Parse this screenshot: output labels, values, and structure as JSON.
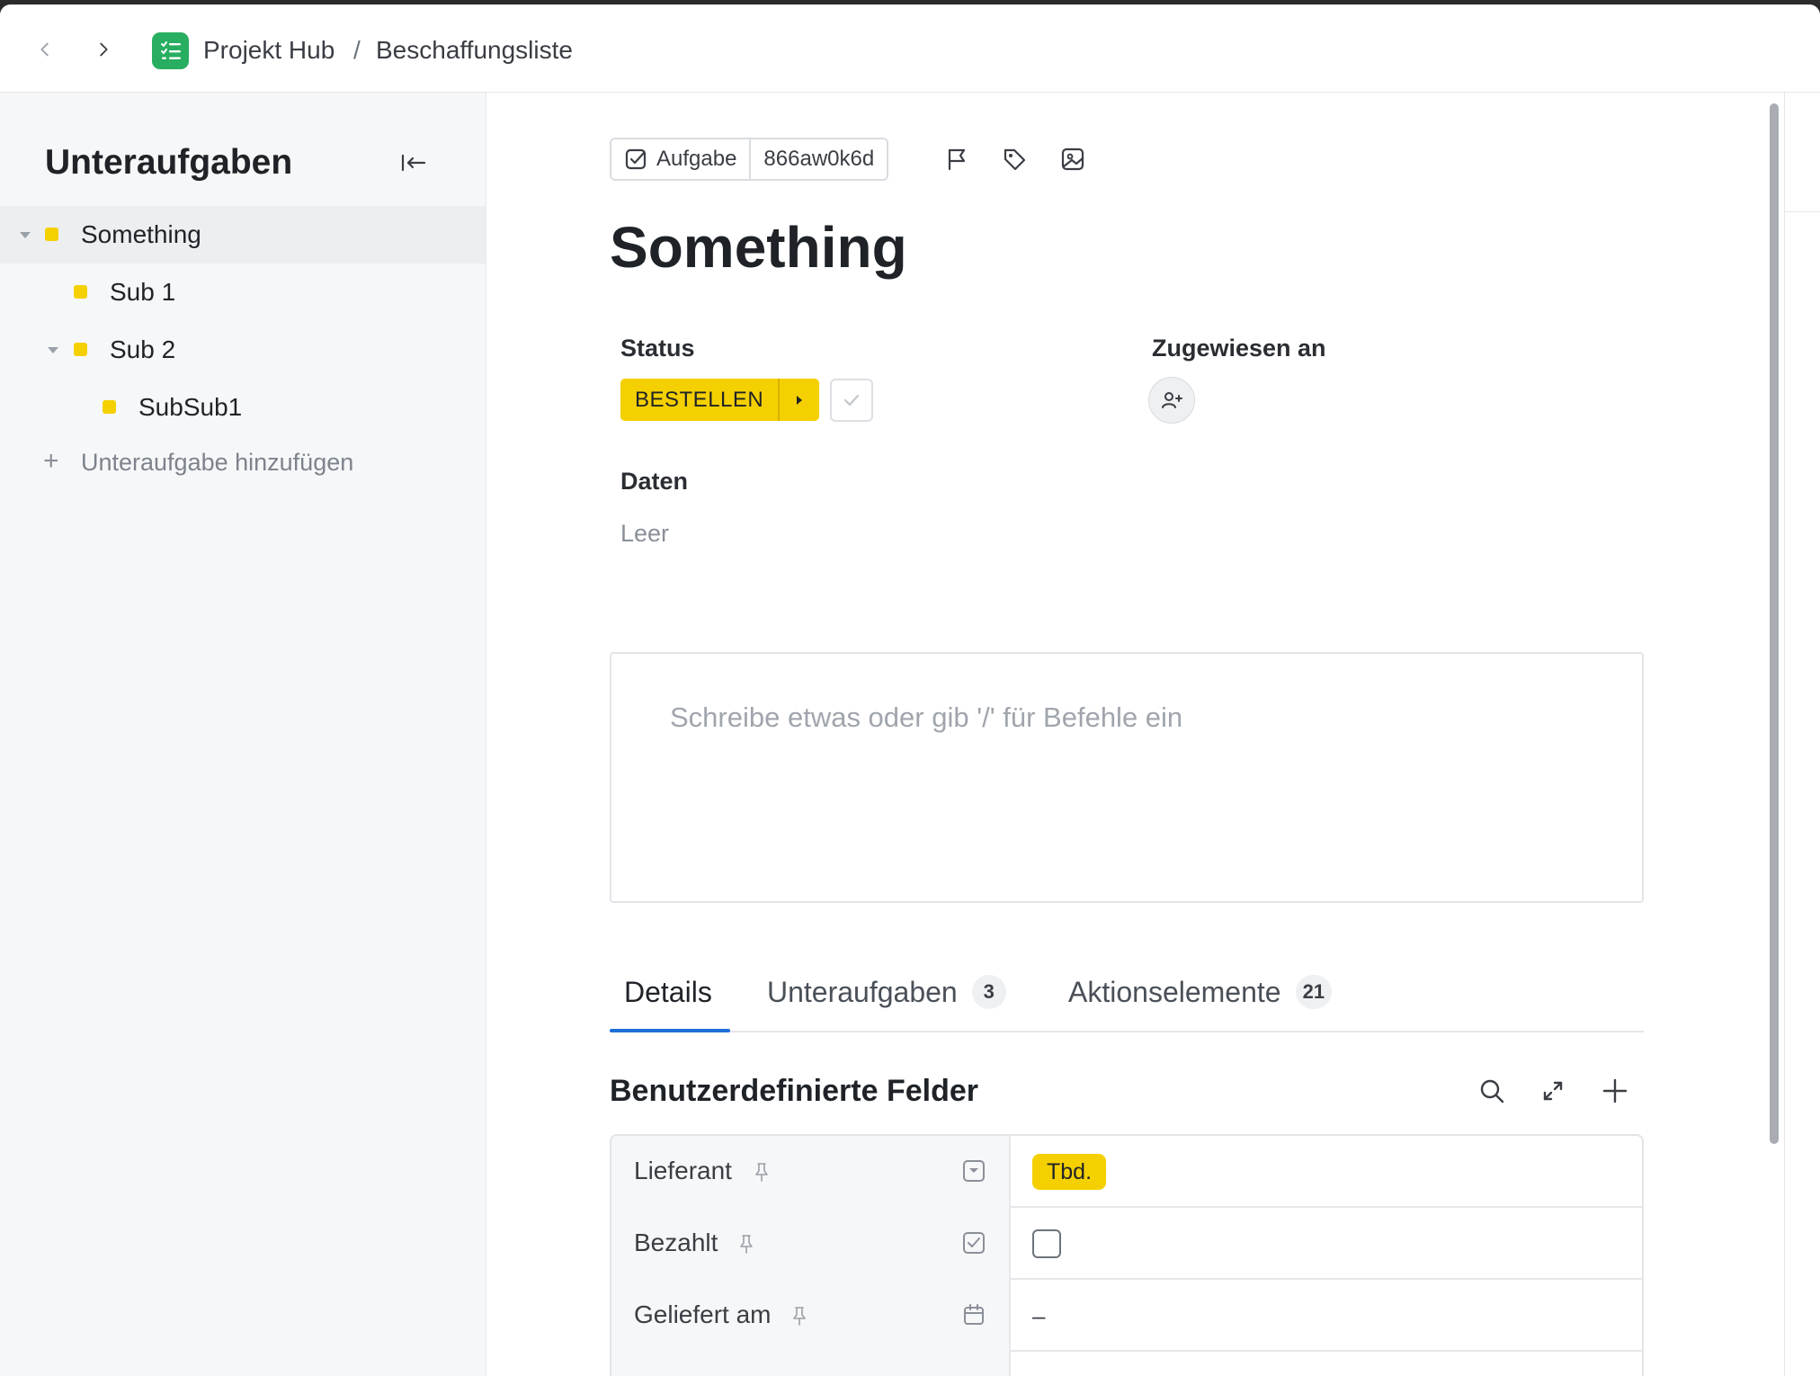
{
  "breadcrumb": {
    "workspace": "Projekt Hub",
    "separator": "/",
    "list": "Beschaffungsliste"
  },
  "sidebar": {
    "title": "Unteraufgaben",
    "items": [
      {
        "label": "Something",
        "depth": 0,
        "expanded": true,
        "active": true
      },
      {
        "label": "Sub 1",
        "depth": 1,
        "expanded": null,
        "active": false
      },
      {
        "label": "Sub 2",
        "depth": 1,
        "expanded": true,
        "active": false
      },
      {
        "label": "SubSub1",
        "depth": 2,
        "expanded": null,
        "active": false
      }
    ],
    "add_label": "Unteraufgabe hinzufügen",
    "status_color": "#f5d000"
  },
  "task": {
    "type_label": "Aufgabe",
    "id": "866aw0k6d",
    "title": "Something",
    "status_label": "Status",
    "status_value": "BESTELLEN",
    "status_color": "#f5d000",
    "assignee_label": "Zugewiesen an",
    "dates_label": "Daten",
    "dates_value": "Leer",
    "editor_placeholder": "Schreibe etwas oder gib '/' für Befehle ein"
  },
  "tabs": [
    {
      "label": "Details",
      "count": null,
      "active": true
    },
    {
      "label": "Unteraufgaben",
      "count": "3",
      "active": false
    },
    {
      "label": "Aktionselemente",
      "count": "21",
      "active": false
    }
  ],
  "custom_fields": {
    "title": "Benutzerdefinierte Felder",
    "rows": [
      {
        "label": "Lieferant",
        "type_icon": "dropdown-icon",
        "value": "Tbd."
      },
      {
        "label": "Bezahlt",
        "type_icon": "checkbox-type-icon",
        "value": null
      },
      {
        "label": "Geliefert am",
        "type_icon": "calendar-icon",
        "value": "–"
      }
    ]
  },
  "accent_color": "#1e6fd9",
  "app_icon_color": "#27ae60"
}
